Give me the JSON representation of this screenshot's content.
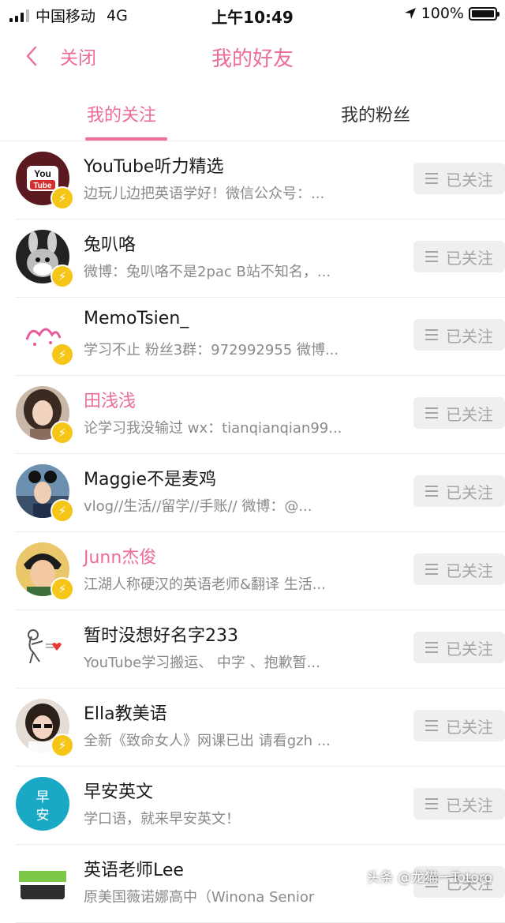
{
  "status_bar": {
    "carrier": "中国移动",
    "network": "4G",
    "time": "上午10:49",
    "battery": "100%"
  },
  "nav": {
    "back_label": "关闭",
    "title": "我的好友"
  },
  "tabs": [
    {
      "label": "我的关注",
      "active": true
    },
    {
      "label": "我的粉丝",
      "active": false
    }
  ],
  "follow_label": "已关注",
  "users": [
    {
      "name": "YouTube听力精选",
      "desc": "边玩儿边把英语学好！微信公众号：...",
      "highlight": false
    },
    {
      "name": "兔叭咯",
      "desc": "微博：兔叭咯不是2pac B站不知名，...",
      "highlight": false
    },
    {
      "name": "MemoTsien_",
      "desc": "学习不止 粉丝3群：972992955 微博...",
      "highlight": false
    },
    {
      "name": "田浅浅",
      "desc": "论学习我没输过 wx：tianqianqian99...",
      "highlight": true
    },
    {
      "name": "Maggie不是麦鸡",
      "desc": "vlog//生活//留学//手账// 微博：@...",
      "highlight": false
    },
    {
      "name": "Junn杰俊",
      "desc": "江湖人称硬汉的英语老师&翻译 生活...",
      "highlight": true
    },
    {
      "name": "暂时没想好名字233",
      "desc": "YouTube学习搬运、 中字 、抱歉暂...",
      "highlight": false
    },
    {
      "name": "Ella教美语",
      "desc": "全新《致命女人》网课已出 请看gzh ...",
      "highlight": false
    },
    {
      "name": "早安英文",
      "desc": "学口语，就来早安英文！",
      "highlight": false
    },
    {
      "name": "英语老师Lee",
      "desc": "原美国薇诺娜高中（Winona Senior",
      "highlight": false
    }
  ],
  "watermark": "头条 @龙猫一Totoro",
  "colors": {
    "accent": "#ec6d96",
    "badge": "#f5c518"
  }
}
